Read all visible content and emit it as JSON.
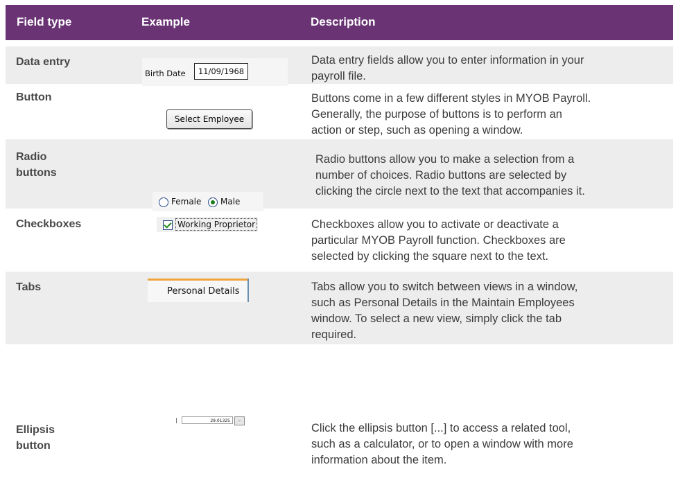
{
  "table": {
    "headers": [
      "Field type",
      "Example",
      "Description"
    ],
    "rows": [
      {
        "field_type_lines": [
          "Data entry"
        ],
        "example": {
          "label": "Birth Date",
          "value": "11/09/1968"
        },
        "description_lines": [
          "Data entry fields allow you to enter information in your",
          "payroll file."
        ]
      },
      {
        "field_type_lines": [
          "Button"
        ],
        "example": {
          "label": "Select Employee"
        },
        "description_lines": [
          "Buttons come in a few different styles in MYOB Payroll.",
          "Generally, the purpose of buttons is to perform an",
          "action or step, such as opening a window."
        ]
      },
      {
        "field_type_lines": [
          "Radio",
          "buttons"
        ],
        "example": {
          "options": [
            "Female",
            "Male"
          ],
          "selected": "Male"
        },
        "description_lines": [
          "Radio buttons allow you to make a selection from a",
          "number of choices. Radio buttons are selected by",
          "clicking the circle next to the text that accompanies it."
        ]
      },
      {
        "field_type_lines": [
          "Checkboxes"
        ],
        "example": {
          "label": "Working Proprietor",
          "checked": true
        },
        "description_lines": [
          "Checkboxes allow you to activate or deactivate a",
          "particular MYOB Payroll function. Checkboxes are",
          "selected by clicking the square next to the text."
        ]
      },
      {
        "field_type_lines": [
          "Tabs"
        ],
        "example": {
          "label": "Personal Details"
        },
        "description_lines": [
          "Tabs allow you to switch between views in a window,",
          "such as Personal Details in the Maintain Employees",
          "window. To select a new view, simply click the tab",
          "required."
        ]
      },
      {
        "field_type_lines": [
          "Ellipsis",
          "button"
        ],
        "example": {
          "value": "29.01325",
          "button": "..."
        },
        "description_lines": [
          "Click the ellipsis button [...] to access a related tool,",
          "such as a calculator, or to open a window with more",
          "information about the item."
        ]
      }
    ]
  },
  "colors": {
    "header_bg": "#6a3474",
    "row_shade": "#ededed",
    "header_text": "#ffffff"
  }
}
